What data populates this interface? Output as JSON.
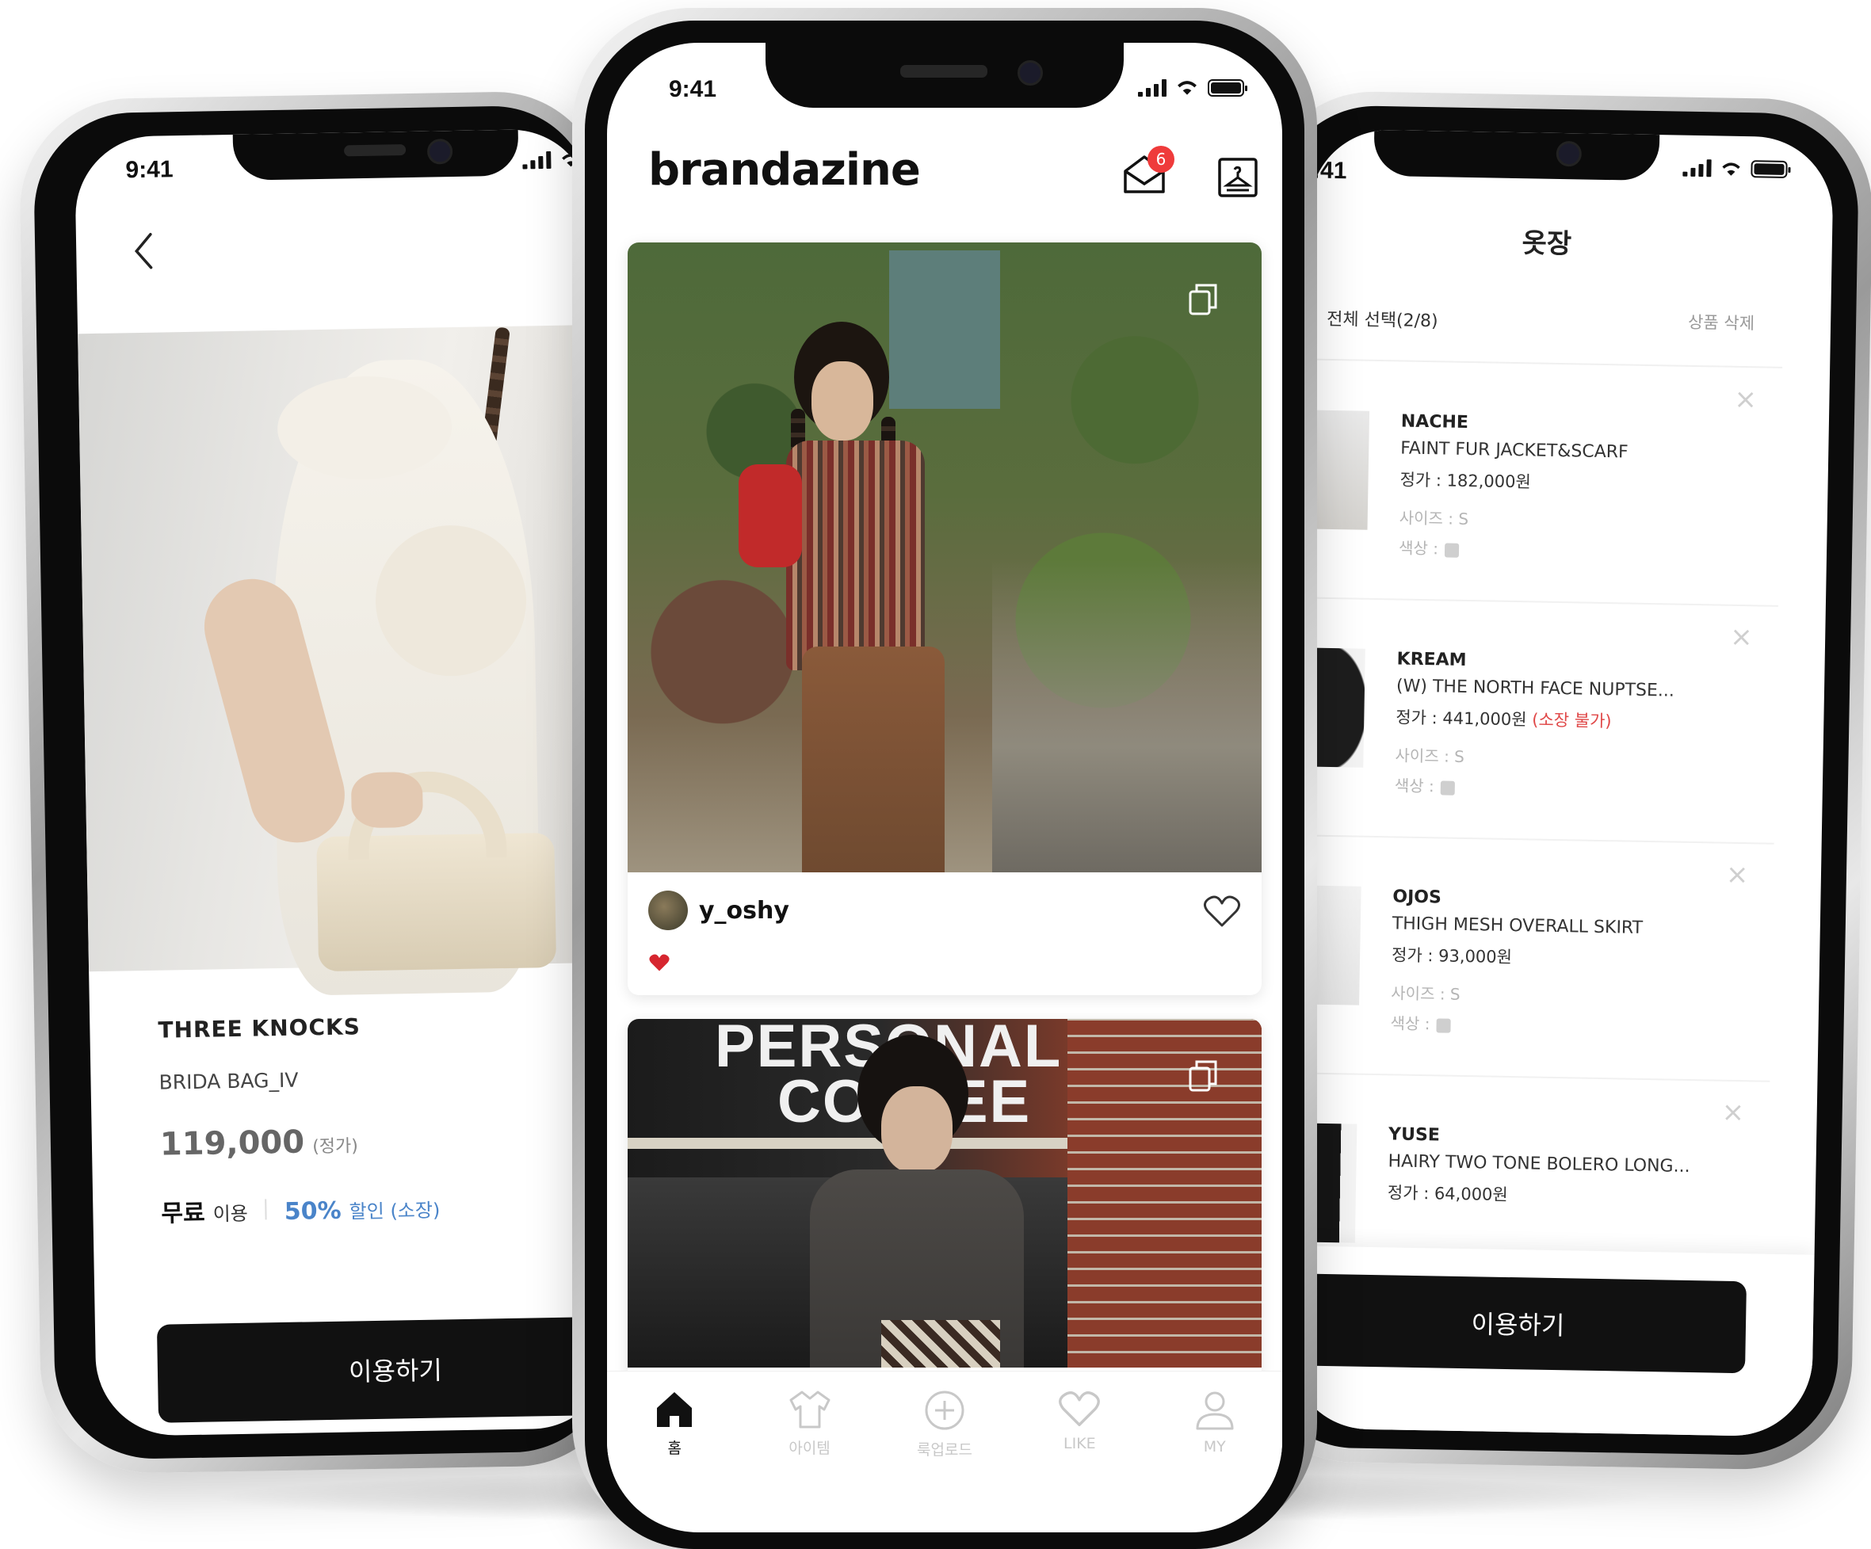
{
  "left_phone": {
    "time": "9:41",
    "brand": "THREE KNOCKS",
    "product": "BRIDA BAG_IV",
    "price": "119,000",
    "price_note": "(정가)",
    "free_label": "무료",
    "use_label": "이용",
    "discount": "50%",
    "discount_label": "할인 (소장)",
    "cta": "이용하기"
  },
  "center_phone": {
    "time": "9:41",
    "logo": "brandazine",
    "notification_count": "6",
    "post1": {
      "username": "y_oshy"
    },
    "post2": {
      "sign_line1": "PERSONAL",
      "sign_line2": "COFFEE"
    },
    "tabs": [
      {
        "label": "홈",
        "icon": "home-icon"
      },
      {
        "label": "아이템",
        "icon": "shirt-icon"
      },
      {
        "label": "룩업로드",
        "icon": "plus-circle-icon"
      },
      {
        "label": "LIKE",
        "icon": "heart-icon"
      },
      {
        "label": "MY",
        "icon": "user-icon"
      }
    ]
  },
  "right_phone": {
    "time": "9:41",
    "title": "옷장",
    "select_all": "전체 선택(2/8)",
    "delete": "상품 삭제",
    "items": [
      {
        "brand": "NACHE",
        "name": "FAINT FUR JACKET&SCARF",
        "price": "정가 : 182,000원",
        "unavailable": "",
        "size": "사이즈 : S",
        "color": "색상 :"
      },
      {
        "brand": "KREAM",
        "name": "(W) THE NORTH FACE NUPTSE...",
        "price": "정가 : 441,000원",
        "unavailable": "(소장 불가)",
        "size": "사이즈 : S",
        "color": "색상 :"
      },
      {
        "brand": "OJOS",
        "name": "THIGH MESH OVERALL SKIRT",
        "price": "정가 : 93,000원",
        "unavailable": "",
        "size": "사이즈 : S",
        "color": "색상 :"
      },
      {
        "brand": "YUSE",
        "name": "HAIRY TWO TONE BOLERO LONG...",
        "price": "정가 : 64,000원",
        "unavailable": "",
        "size": "",
        "color": ""
      }
    ],
    "cta": "이용하기"
  },
  "colors": {
    "accent_blue": "#4a84c9",
    "badge_red": "#ef3b3b",
    "warning_red": "#e04848"
  }
}
